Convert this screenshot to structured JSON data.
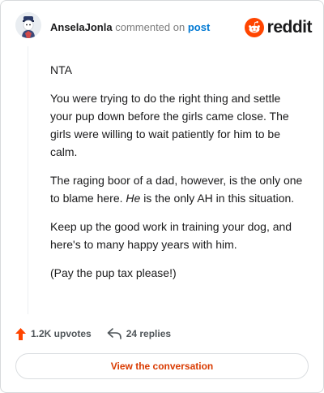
{
  "comment": {
    "author": "AnselaJonla",
    "action_text": "commented on",
    "post_link": "post",
    "paragraphs": [
      "NTA",
      "You were trying to do the right thing and settle your pup down before the girls came close. The girls were willing to wait patiently for him to be calm.",
      "The raging boor of a dad, however, is the only one to blame here.",
      "He",
      "is the only AH in this situation.",
      "Keep up the good work in training your dog, and here's to many happy years with him.",
      "(Pay the pup tax please!)"
    ]
  },
  "brand": {
    "logo_text": "reddit",
    "color": "#ff4500"
  },
  "stats": {
    "upvotes": "1.2K upvotes",
    "replies": "24 replies",
    "upvote_color": "#ff4500"
  },
  "actions": {
    "view_conversation": "View the conversation"
  },
  "icons": {
    "upvote": "upvote-arrow-icon",
    "reply": "reply-arrow-icon",
    "logo": "reddit-snoo-icon"
  }
}
